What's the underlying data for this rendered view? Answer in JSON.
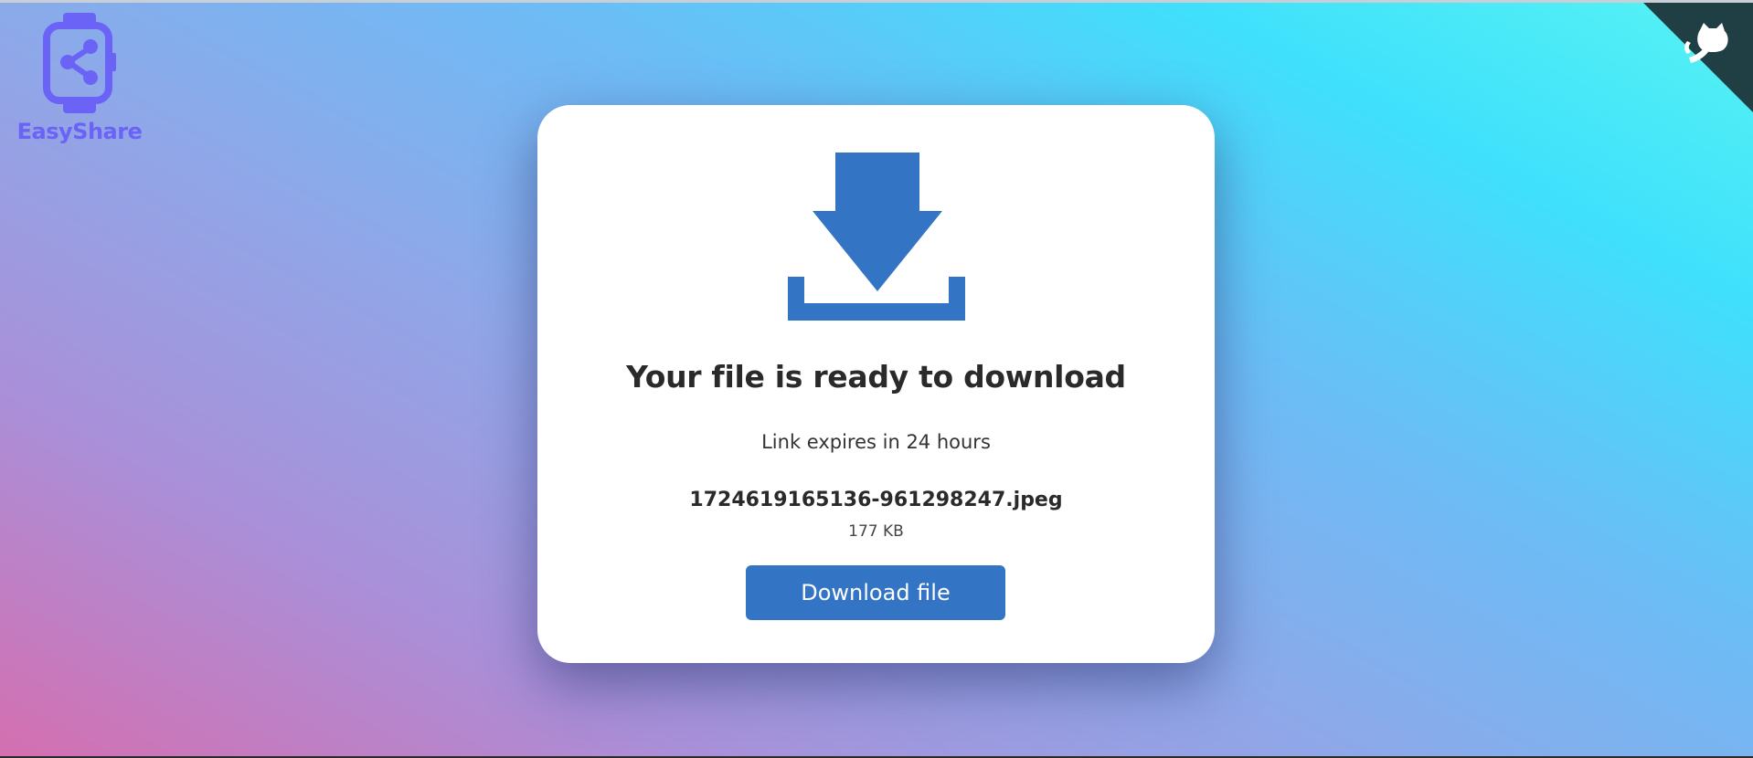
{
  "brand": {
    "name": "EasyShare",
    "logo_icon": "smartwatch-share-icon",
    "color": "#6b63f6"
  },
  "corner": {
    "icon": "github-octocat-icon",
    "color": "#1f3f45"
  },
  "card": {
    "icon": "download-icon",
    "icon_color": "#3375c4",
    "title": "Your file is ready to download",
    "expiry": "Link expires in 24 hours",
    "file": {
      "name": "1724619165136-961298247.jpeg",
      "size": "177 KB"
    },
    "button_label": "Download file",
    "button_color": "#3375c4"
  }
}
